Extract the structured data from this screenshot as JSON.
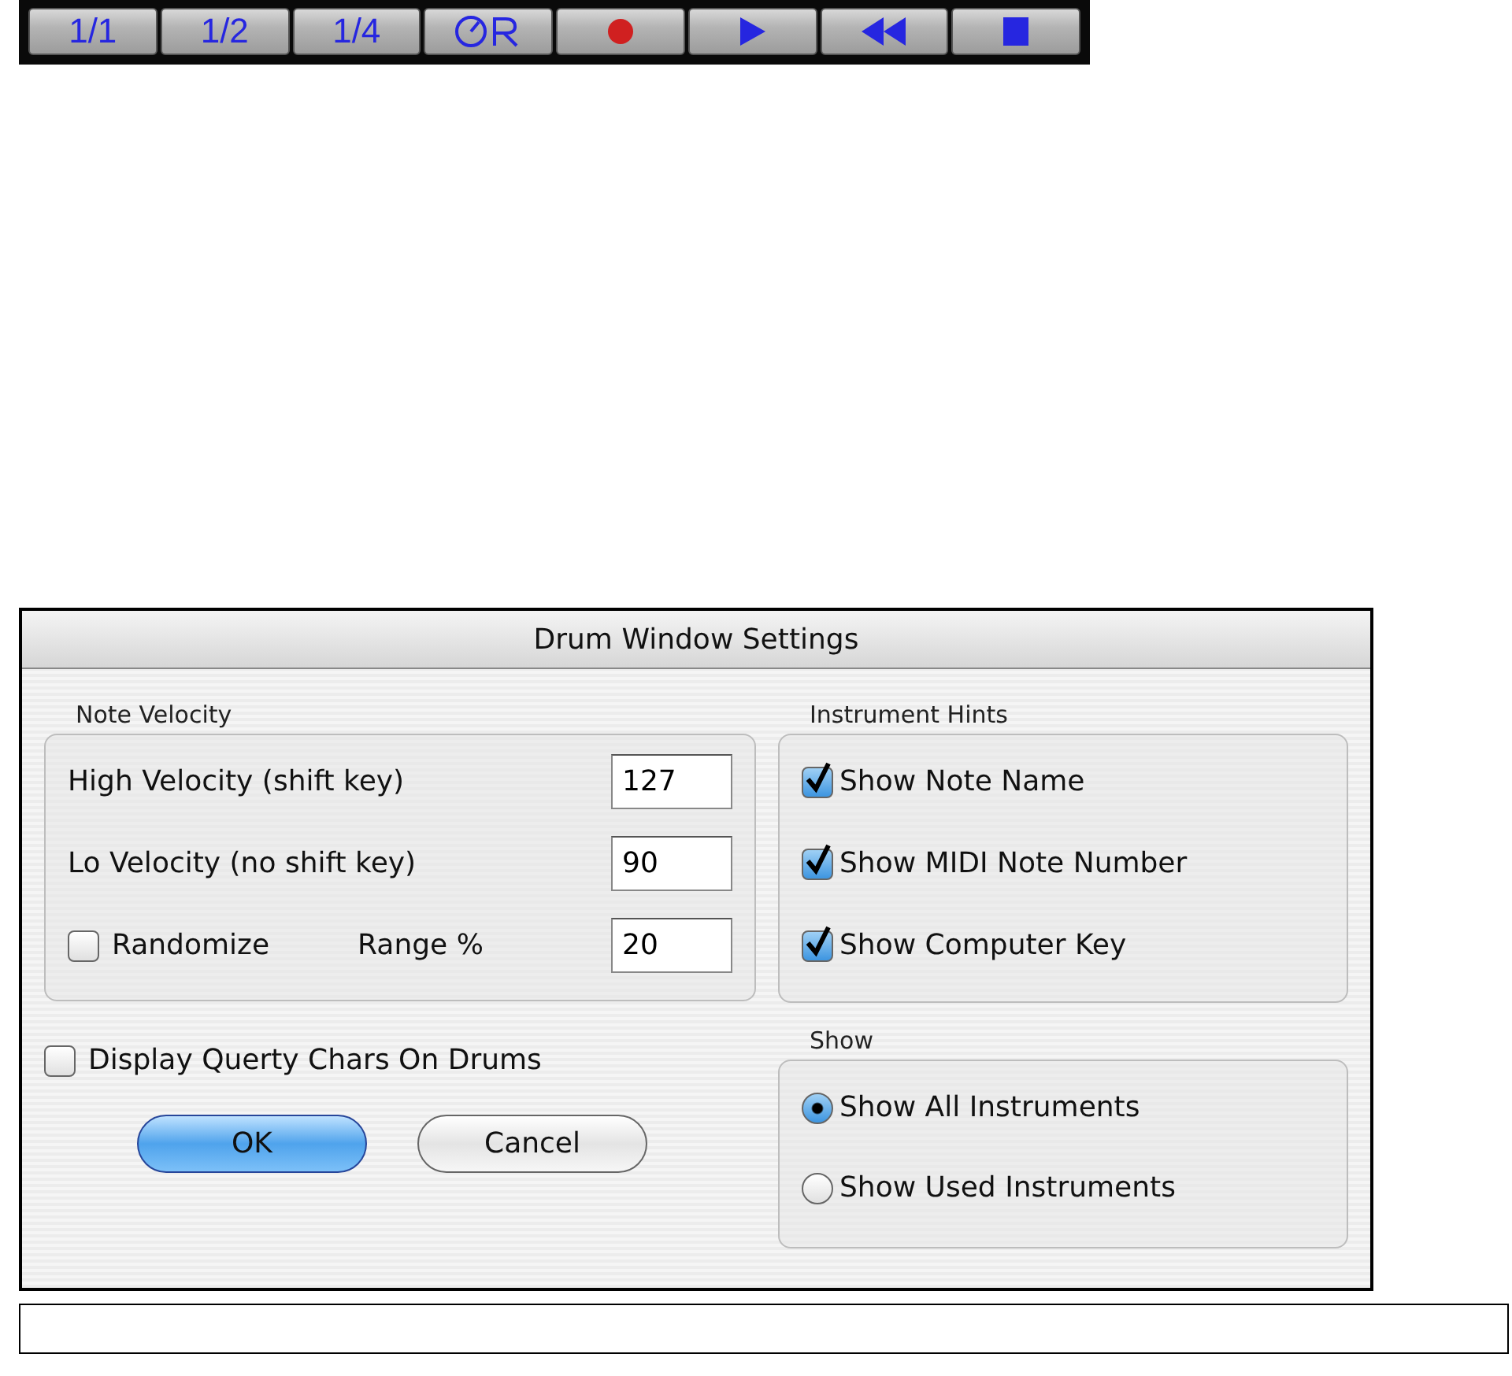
{
  "toolbar": {
    "buttons": [
      {
        "kind": "text",
        "label": "1/1"
      },
      {
        "kind": "text",
        "label": "1/2"
      },
      {
        "kind": "text",
        "label": "1/4"
      },
      {
        "kind": "clock"
      },
      {
        "kind": "record"
      },
      {
        "kind": "play"
      },
      {
        "kind": "rewind"
      },
      {
        "kind": "stop"
      }
    ]
  },
  "dialog": {
    "title": "Drum Window Settings",
    "note_velocity": {
      "title": "Note Velocity",
      "fields": [
        {
          "label": "High Velocity (shift key)",
          "value": "127"
        },
        {
          "label": "Lo Velocity (no shift key)",
          "value": "90"
        }
      ],
      "randomize": {
        "label": "Randomize",
        "checked": false
      },
      "range": {
        "label": "Range %",
        "value": "20"
      }
    },
    "display_querty": {
      "label": "Display Querty Chars On Drums",
      "checked": false
    },
    "instrument_hints": {
      "title": "Instrument Hints",
      "options": [
        {
          "label": "Show Note Name",
          "checked": true
        },
        {
          "label": "Show MIDI Note Number",
          "checked": true
        },
        {
          "label": "Show Computer Key",
          "checked": true
        }
      ]
    },
    "show": {
      "title": "Show",
      "options": [
        {
          "label": "Show All Instruments",
          "selected": true
        },
        {
          "label": "Show Used Instruments",
          "selected": false
        }
      ]
    },
    "buttons": [
      {
        "label": "OK",
        "default": true
      },
      {
        "label": "Cancel",
        "default": false
      }
    ]
  }
}
